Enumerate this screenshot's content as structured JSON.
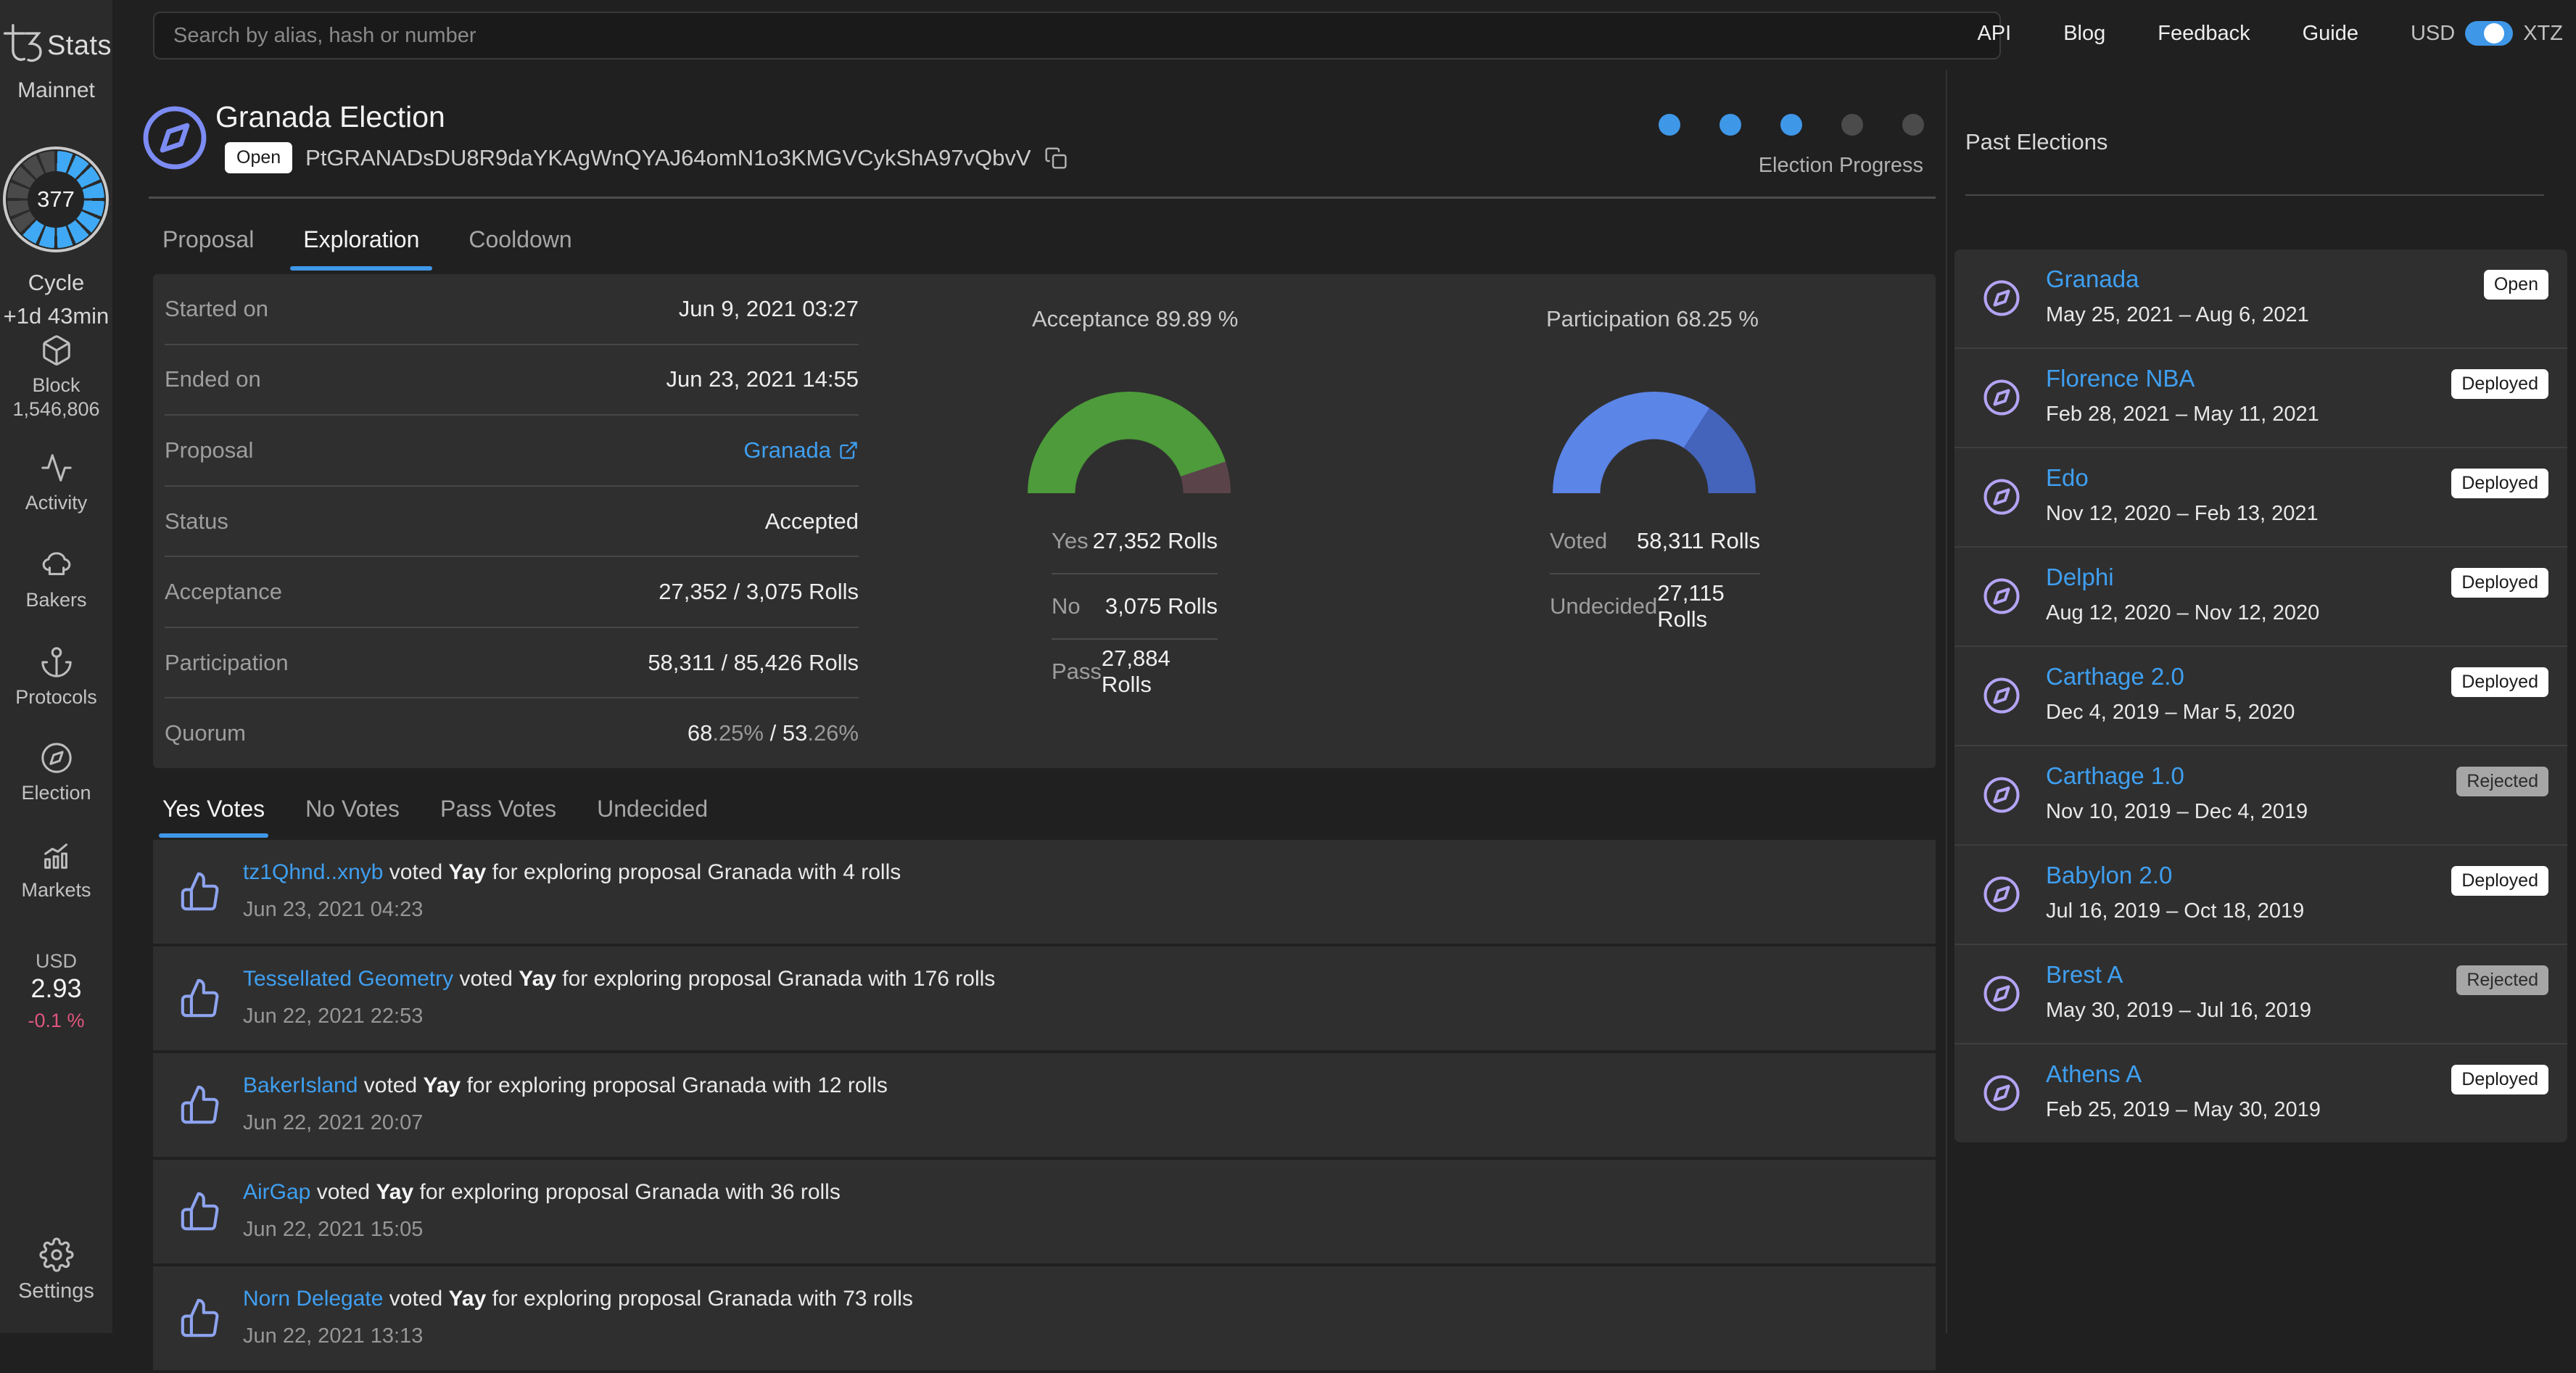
{
  "topbar": {
    "search_placeholder": "Search by alias, hash or number",
    "links": [
      "API",
      "Blog",
      "Feedback",
      "Guide"
    ],
    "currency": {
      "left": "USD",
      "right": "XTZ"
    }
  },
  "sidebar": {
    "logo_text": "Stats",
    "network": "Mainnet",
    "cycle": {
      "number": "377",
      "label": "Cycle",
      "eta": "+1d 43min",
      "segments_total": 16,
      "segments_filled": 10
    },
    "nav": [
      {
        "label": "Block",
        "value": "1,546,806",
        "icon": "block-icon"
      },
      {
        "label": "Activity",
        "icon": "activity-icon"
      },
      {
        "label": "Bakers",
        "icon": "baker-hat-icon"
      },
      {
        "label": "Protocols",
        "icon": "anchor-icon"
      },
      {
        "label": "Election",
        "icon": "compass-icon"
      },
      {
        "label": "Markets",
        "icon": "bar-chart-icon"
      }
    ],
    "price": {
      "currency": "USD",
      "value": "2.93",
      "change": "-0.1 %"
    },
    "settings_label": "Settings"
  },
  "header": {
    "title": "Granada Election",
    "status_badge": "Open",
    "hash": "PtGRANADsDU8R9daYKAgWnQYAJ64omN1o3KMGVCykShA97vQbvV",
    "progress": {
      "label": "Election Progress",
      "dots_total": 5,
      "dots_active": 3
    }
  },
  "phase_tabs": {
    "items": [
      "Proposal",
      "Exploration",
      "Cooldown"
    ],
    "active": 1
  },
  "details": {
    "rows": [
      {
        "label": "Started on",
        "value": "Jun 9, 2021 03:27"
      },
      {
        "label": "Ended on",
        "value": "Jun 23, 2021 14:55"
      },
      {
        "label": "Proposal",
        "value": "Granada"
      },
      {
        "label": "Status",
        "value": "Accepted"
      },
      {
        "label": "Acceptance",
        "value": "27,352 / 3,075 Rolls"
      },
      {
        "label": "Participation",
        "value": "58,311 / 85,426 Rolls"
      },
      {
        "label": "Quorum",
        "value": "68.25% / 53.26%"
      }
    ],
    "quorum_parts": {
      "int1": "68",
      "dec1": ".25%",
      "sep": " / ",
      "int2": "53",
      "dec2": ".26%"
    }
  },
  "gauges": {
    "acceptance": {
      "title": "Acceptance 89.89 %",
      "percent": 89.89,
      "color_main": "#4d9b3a",
      "color_rest": "#5a444a",
      "legend": [
        {
          "label": "Yes",
          "value": "27,352 Rolls"
        },
        {
          "label": "No",
          "value": "3,075 Rolls"
        },
        {
          "label": "Pass",
          "value": "27,884 Rolls"
        }
      ]
    },
    "participation": {
      "title": "Participation 68.25 %",
      "percent": 68.25,
      "color_main": "#5c85e8",
      "color_rest": "#4463bb",
      "legend": [
        {
          "label": "Voted",
          "value": "58,311 Rolls"
        },
        {
          "label": "Undecided",
          "value": "27,115 Rolls"
        }
      ]
    }
  },
  "votes": {
    "tabs": [
      "Yes Votes",
      "No Votes",
      "Pass Votes",
      "Undecided"
    ],
    "active": 0,
    "items": [
      {
        "name": "tz1Qhnd..xnyb",
        "action": "voted",
        "vote": "Yay",
        "rest": "for exploring proposal Granada with 4 rolls",
        "date": "Jun 23, 2021 04:23"
      },
      {
        "name": "Tessellated Geometry",
        "action": "voted",
        "vote": "Yay",
        "rest": "for exploring proposal Granada with 176 rolls",
        "date": "Jun 22, 2021 22:53"
      },
      {
        "name": "BakerIsland",
        "action": "voted",
        "vote": "Yay",
        "rest": "for exploring proposal Granada with 12 rolls",
        "date": "Jun 22, 2021 20:07"
      },
      {
        "name": "AirGap",
        "action": "voted",
        "vote": "Yay",
        "rest": "for exploring proposal Granada with 36 rolls",
        "date": "Jun 22, 2021 15:05"
      },
      {
        "name": "Norn Delegate",
        "action": "voted",
        "vote": "Yay",
        "rest": "for exploring proposal Granada with 73 rolls",
        "date": "Jun 22, 2021 13:13"
      }
    ]
  },
  "past_elections": {
    "title": "Past Elections",
    "items": [
      {
        "name": "Granada",
        "dates": "May 25, 2021 – Aug 6, 2021",
        "badge": "Open",
        "badge_variant": "light"
      },
      {
        "name": "Florence NBA",
        "dates": "Feb 28, 2021 – May 11, 2021",
        "badge": "Deployed",
        "badge_variant": "light"
      },
      {
        "name": "Edo",
        "dates": "Nov 12, 2020 – Feb 13, 2021",
        "badge": "Deployed",
        "badge_variant": "light"
      },
      {
        "name": "Delphi",
        "dates": "Aug 12, 2020 – Nov 12, 2020",
        "badge": "Deployed",
        "badge_variant": "light"
      },
      {
        "name": "Carthage 2.0",
        "dates": "Dec 4, 2019 – Mar 5, 2020",
        "badge": "Deployed",
        "badge_variant": "light"
      },
      {
        "name": "Carthage 1.0",
        "dates": "Nov 10, 2019 – Dec 4, 2019",
        "badge": "Rejected",
        "badge_variant": "muted"
      },
      {
        "name": "Babylon 2.0",
        "dates": "Jul 16, 2019 – Oct 18, 2019",
        "badge": "Deployed",
        "badge_variant": "light"
      },
      {
        "name": "Brest A",
        "dates": "May 30, 2019 – Jul 16, 2019",
        "badge": "Rejected",
        "badge_variant": "muted"
      },
      {
        "name": "Athens A",
        "dates": "Feb 25, 2019 – May 30, 2019",
        "badge": "Deployed",
        "badge_variant": "light"
      }
    ]
  },
  "colors": {
    "accent_blue": "#3f97e8",
    "link_blue": "#3f9ff0",
    "ring_blue": "#3fa9f5",
    "ring_gray": "#4a4a4a",
    "dot_inactive": "#4b4b4b",
    "thumb_icon": "#8ea4f0",
    "compass_header": "#7c8cf4",
    "compass_list": "#b4a4f4",
    "price_change": "#e0557d"
  },
  "chart_data": [
    {
      "type": "pie",
      "title": "Acceptance 89.89 %",
      "categories": [
        "Yes share",
        "No share"
      ],
      "values": [
        89.89,
        10.11
      ],
      "legend_position": "below",
      "note": "half-donut gauge; Yes 27,352 rolls, No 3,075 rolls, Pass 27,884 rolls"
    },
    {
      "type": "pie",
      "title": "Participation 68.25 %",
      "categories": [
        "Voted",
        "Undecided"
      ],
      "values": [
        68.25,
        31.75
      ],
      "legend_position": "below",
      "note": "half-donut gauge; Voted 58,311 rolls, Undecided 27,115 rolls"
    },
    {
      "type": "pie",
      "title": "Cycle 377 progress ring",
      "categories": [
        "complete",
        "remaining"
      ],
      "values": [
        10,
        6
      ],
      "note": "16-segment ring, 10 filled blue"
    }
  ]
}
